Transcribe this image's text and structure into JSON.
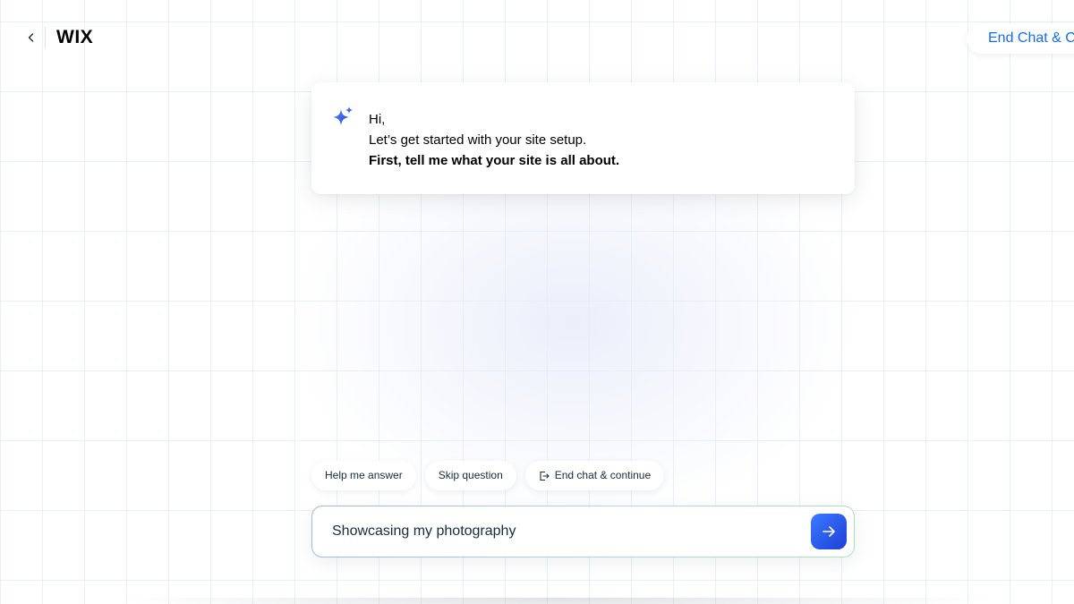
{
  "header": {
    "logo": "WIX",
    "end_chat_label": "End Chat & Continue",
    "back_icon": "chevron-left-icon"
  },
  "message": {
    "icon": "sparkle-icon",
    "line1": "Hi,",
    "line2": "Let’s get started with your site setup.",
    "line3": "First, tell me what your site is all about."
  },
  "chips": {
    "help": "Help me answer",
    "skip": "Skip question",
    "end": "End chat & continue",
    "end_icon": "exit-icon"
  },
  "input": {
    "value": "Showcasing my photography",
    "send_icon": "arrow-right-icon"
  },
  "colors": {
    "accent": "#116dff",
    "send_gradient_start": "#3a7bff",
    "send_gradient_end": "#1f3fd8",
    "sparkle": "#3b6cf6"
  }
}
